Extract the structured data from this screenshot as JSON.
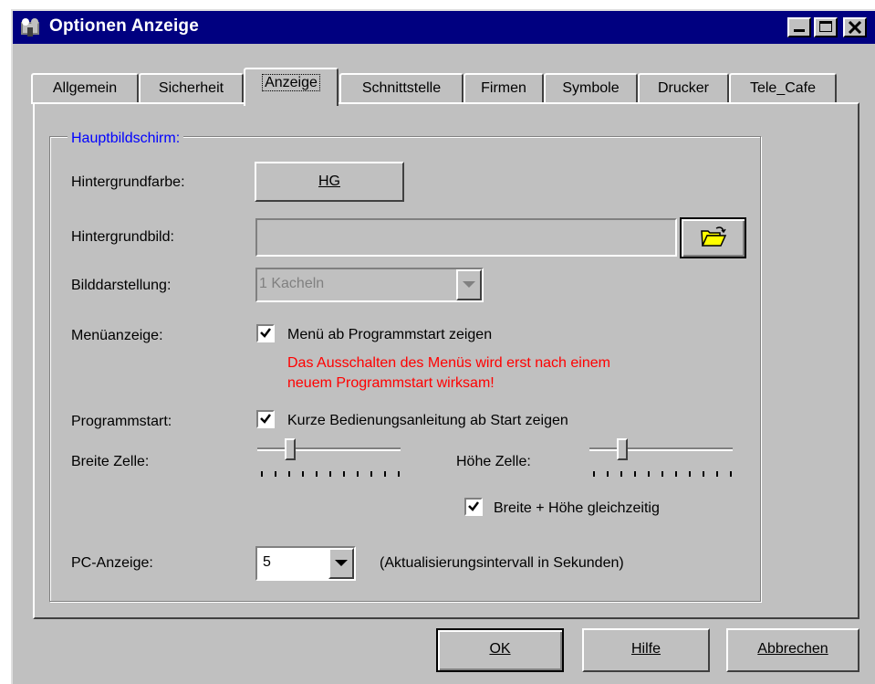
{
  "window": {
    "title": "Optionen Anzeige"
  },
  "tabs": [
    {
      "label": "Allgemein"
    },
    {
      "label": "Sicherheit"
    },
    {
      "label": "Anzeige"
    },
    {
      "label": "Schnittstelle"
    },
    {
      "label": "Firmen"
    },
    {
      "label": "Symbole"
    },
    {
      "label": "Drucker"
    },
    {
      "label": "Tele_Cafe"
    }
  ],
  "active_tab": "Anzeige",
  "group": {
    "title": "Hauptbildschirm:",
    "background_color": {
      "label": "Hintergrundfarbe:",
      "button_label": "HG"
    },
    "background_image": {
      "label": "Hintergrundbild:",
      "value": ""
    },
    "image_display": {
      "label": "Bilddarstellung:",
      "value": "1 Kacheln"
    },
    "menu_display": {
      "label": "Menüanzeige:",
      "checkbox_label": "Menü ab Programmstart zeigen",
      "checked": true,
      "warning_line1": "Das Ausschalten des Menüs wird erst nach einem",
      "warning_line2": "neuem Programmstart wirksam!"
    },
    "program_start": {
      "label": "Programmstart:",
      "checkbox_label": "Kurze Bedienungsanleitung ab Start zeigen",
      "checked": true
    },
    "cell_width": {
      "label": "Breite Zelle:"
    },
    "cell_height": {
      "label": "Höhe Zelle:"
    },
    "link_sizes": {
      "checkbox_label": "Breite + Höhe gleichzeitig",
      "checked": true
    },
    "pc_display": {
      "label": "PC-Anzeige:",
      "value": "5",
      "hint": "(Aktualisierungsintervall in Sekunden)"
    }
  },
  "buttons": {
    "ok": "OK",
    "help": "Hilfe",
    "cancel": "Abbrechen"
  }
}
